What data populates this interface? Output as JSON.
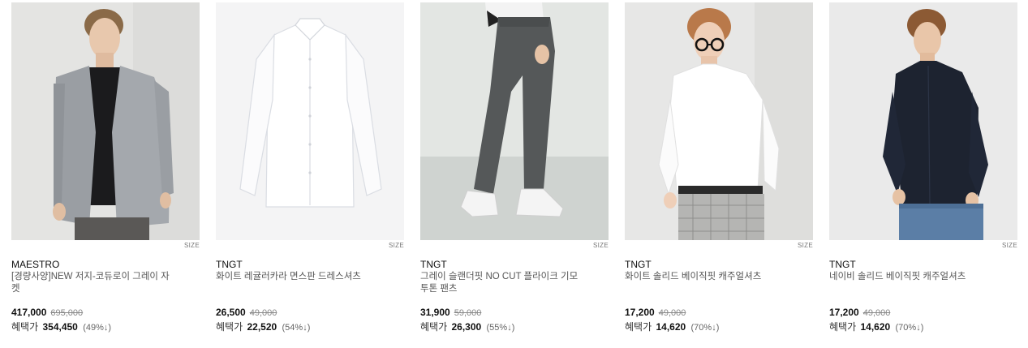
{
  "products": [
    {
      "brand": "MAESTRO",
      "name": "[경량사양]NEW 저지-코듀로이 그레이 자켓",
      "size_label": "SIZE",
      "price": "417,000",
      "original_price": "695,000",
      "benefit_label": "혜택가",
      "benefit_price": "354,450",
      "benefit_rate": "(49%↓)",
      "image": "model-gray-jacket"
    },
    {
      "brand": "TNGT",
      "name": "화이트 레귤러카라 면스판 드레스셔츠",
      "size_label": "SIZE",
      "price": "26,500",
      "original_price": "49,000",
      "benefit_label": "혜택가",
      "benefit_price": "22,520",
      "benefit_rate": "(54%↓)",
      "image": "white-shirt-flat"
    },
    {
      "brand": "TNGT",
      "name": "그레이 슬랜더핏 NO CUT 플라이크 기모 투톤 팬츠",
      "size_label": "SIZE",
      "price": "31,900",
      "original_price": "59,000",
      "benefit_label": "혜택가",
      "benefit_price": "26,300",
      "benefit_rate": "(55%↓)",
      "image": "gray-pants-model"
    },
    {
      "brand": "TNGT",
      "name": "화이트 솔리드 베이직핏 캐주얼셔츠",
      "size_label": "SIZE",
      "price": "17,200",
      "original_price": "49,000",
      "benefit_label": "혜택가",
      "benefit_price": "14,620",
      "benefit_rate": "(70%↓)",
      "image": "model-white-shirt"
    },
    {
      "brand": "TNGT",
      "name": "네이비 솔리드 베이직핏 캐주얼셔츠",
      "size_label": "SIZE",
      "price": "17,200",
      "original_price": "49,000",
      "benefit_label": "혜택가",
      "benefit_price": "14,620",
      "benefit_rate": "(70%↓)",
      "image": "model-navy-shirt"
    }
  ]
}
